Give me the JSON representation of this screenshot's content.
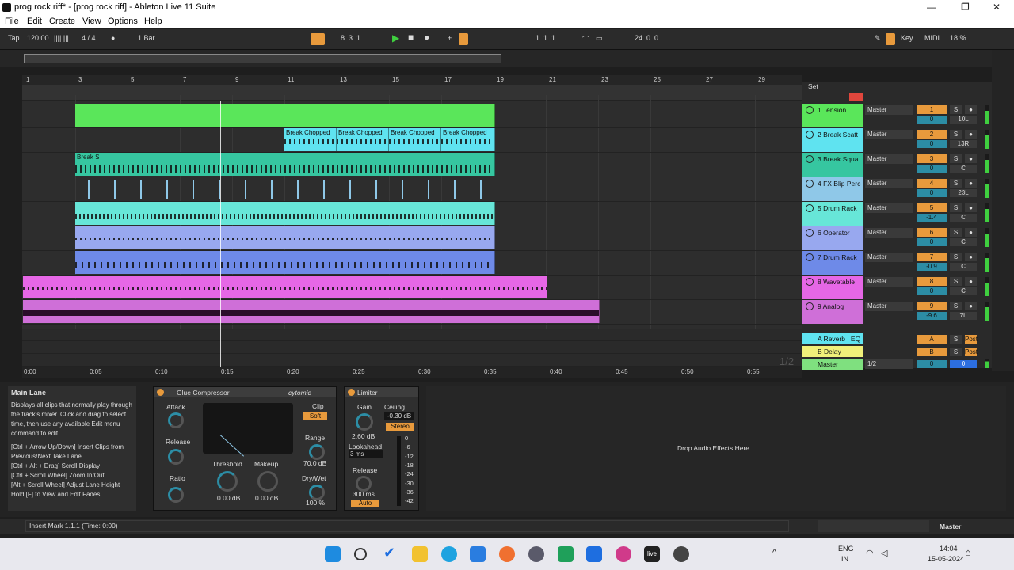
{
  "window": {
    "title": "prog rock riff* - [prog rock riff] - Ableton Live 11 Suite"
  },
  "menu": [
    "File",
    "Edit",
    "Create",
    "View",
    "Options",
    "Help"
  ],
  "control_bar": {
    "tap": "Tap",
    "tempo": "120.00",
    "signature": "4 / 4",
    "metro": "●",
    "quant": "1 Bar",
    "position": "8. 3. 1",
    "loop_start": "1. 1. 1",
    "loop_len": "24. 0. 0",
    "key": "Key",
    "midi": "MIDI",
    "cpu": "18 %"
  },
  "ruler": [
    "1",
    "3",
    "5",
    "7",
    "9",
    "11",
    "13",
    "15",
    "17",
    "19",
    "21",
    "23",
    "25",
    "27",
    "29"
  ],
  "time_axis": [
    "0:00",
    "0:05",
    "0:10",
    "0:15",
    "0:20",
    "0:25",
    "0:30",
    "0:35",
    "0:40",
    "0:45",
    "0:50",
    "0:55"
  ],
  "page_indicator": "1/2",
  "mixer": {
    "set_label": "Set",
    "tracks": [
      {
        "name": "1 Tension",
        "num": "1",
        "vol": "0",
        "pan": "10L",
        "color": "#5ae65a",
        "route": "Master"
      },
      {
        "name": "2 Break Scatt",
        "num": "2",
        "vol": "0",
        "pan": "13R",
        "color": "#5fe3f0",
        "route": "Master"
      },
      {
        "name": "3 Break Squa",
        "num": "3",
        "vol": "0",
        "pan": "C",
        "color": "#36c6a0",
        "route": "Master"
      },
      {
        "name": "4 FX Blip Perc",
        "num": "4",
        "vol": "0",
        "pan": "23L",
        "color": "#8fc8e8",
        "route": "Master"
      },
      {
        "name": "5 Drum Rack",
        "num": "5",
        "vol": "-1.4",
        "pan": "C",
        "color": "#67e6d8",
        "route": "Master"
      },
      {
        "name": "6 Operator",
        "num": "6",
        "vol": "0",
        "pan": "C",
        "color": "#98a8ef",
        "route": "Master"
      },
      {
        "name": "7 Drum Rack",
        "num": "7",
        "vol": "-0.9",
        "pan": "C",
        "color": "#6e8ae8",
        "route": "Master"
      },
      {
        "name": "8 Wavetable",
        "num": "8",
        "vol": "0",
        "pan": "C",
        "color": "#e667e6",
        "route": "Master"
      },
      {
        "name": "9 Analog",
        "num": "9",
        "vol": "-9.6",
        "pan": "7L",
        "color": "#cf6fd8",
        "route": "Master"
      }
    ],
    "returns": [
      {
        "name": "A Reverb | EQ",
        "letter": "A",
        "route": "",
        "color": "#5fe3f0"
      },
      {
        "name": "B Delay",
        "letter": "B",
        "route": "",
        "color": "#f0f07a"
      }
    ],
    "master": {
      "name": "Master",
      "route": "1/2",
      "vol": "0",
      "pan": "0"
    },
    "solo": "S",
    "post": "Post"
  },
  "clips": {
    "break_chopped": "Break Chopped",
    "break_short": [
      "Bre",
      "Bre",
      "Break S",
      "Bre",
      "Bre",
      "Bre",
      "Bre",
      "Bre",
      "Bre",
      "Break S",
      "Bre",
      "Bre",
      "Bre",
      "Bre",
      "Bre",
      "Bre",
      "Break S",
      "Bre",
      "Bre",
      "Bre",
      "Bre",
      "Bre",
      "Bre",
      "Break S",
      "Bre",
      "Bre",
      "Bre"
    ]
  },
  "info_view": {
    "title": "Main Lane",
    "body": "Displays all clips that normally play through the track's mixer. Click and drag to select time, then use any available Edit menu command to edit.",
    "shortcuts": [
      "[Ctrl + Arrow Up/Down] Insert Clips from Previous/Next Take Lane",
      "[Ctrl + Alt + Drag] Scroll Display",
      "[Ctrl + Scroll Wheel] Zoom In/Out",
      "[Alt + Scroll Wheel] Adjust Lane Height",
      "Hold [F] to View and Edit Fades"
    ]
  },
  "glue": {
    "title": "Glue Compressor",
    "brand": "cytomic",
    "attack": "Attack",
    "release": "Release",
    "ratio": "Ratio",
    "threshold": "Threshold",
    "makeup": "Makeup",
    "threshold_val": "0.00 dB",
    "makeup_val": "0.00 dB",
    "clip": "Clip",
    "soft": "Soft",
    "range": "Range",
    "range_val": "70.0 dB",
    "drywet": "Dry/Wet",
    "drywet_val": "100 %"
  },
  "limiter": {
    "title": "Limiter",
    "gain": "Gain",
    "gain_val": "2.60 dB",
    "ceiling": "Ceiling",
    "ceiling_val": "-0.30 dB",
    "stereo": "Stereo",
    "lookahead": "Lookahead",
    "lookahead_val": "3 ms",
    "release": "Release",
    "release_val": "300 ms",
    "auto": "Auto",
    "scale": [
      "0",
      "-6",
      "-12",
      "-18",
      "-24",
      "-30",
      "-36",
      "-42"
    ]
  },
  "drop_area": "Drop Audio Effects Here",
  "status": {
    "text": "Insert Mark 1.1.1 (Time: 0:00)",
    "master": "Master"
  },
  "taskbar": {
    "lang1": "ENG",
    "lang2": "IN",
    "time": "14:04",
    "date": "15-05-2024"
  }
}
